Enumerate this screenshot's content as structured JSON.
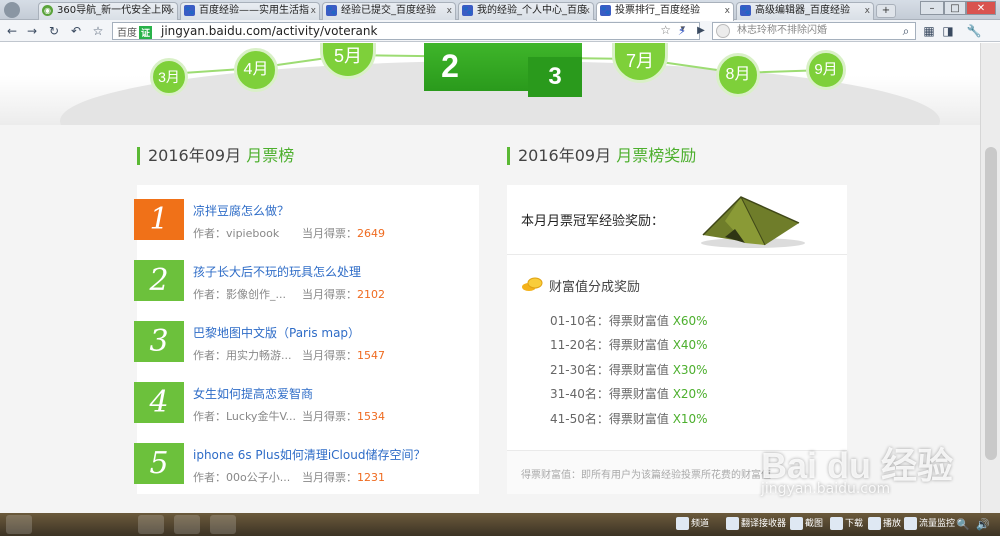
{
  "browser": {
    "tabs": [
      {
        "label": "360导航_新一代安全上网",
        "icon": "360-icon"
      },
      {
        "label": "百度经验——实用生活指",
        "icon": "paw-icon"
      },
      {
        "label": "经验已提交_百度经验",
        "icon": "paw-icon"
      },
      {
        "label": "我的经验_个人中心_百度",
        "icon": "paw-icon"
      },
      {
        "label": "投票排行_百度经验",
        "icon": "paw-icon",
        "active": true
      },
      {
        "label": "高级编辑器_百度经验",
        "icon": "paw-icon"
      }
    ],
    "new_tab_label": "+",
    "window_buttons": {
      "minimize": "–",
      "maximize": "□",
      "close": "✕"
    },
    "site_badge": "百度",
    "site_badge_tag": "证",
    "url": "jingyan.baidu.com/activity/voterank",
    "search_placeholder": "林志玲称不排除闪婚"
  },
  "timeline": {
    "months": [
      {
        "label": "3月"
      },
      {
        "label": "4月"
      },
      {
        "label": "5月"
      },
      {
        "label": "7月"
      },
      {
        "label": "8月"
      },
      {
        "label": "9月"
      }
    ],
    "podium": {
      "left": "2",
      "right": "3"
    }
  },
  "ranking": {
    "title_prefix": "2016年09月",
    "title_highlight": "月票榜",
    "author_prefix": "作者：",
    "votes_prefix": "当月得票：",
    "items": [
      {
        "rank": "1",
        "title": "凉拌豆腐怎么做？",
        "author": "vipiebook",
        "votes": "2649"
      },
      {
        "rank": "2",
        "title": "孩子长大后不玩的玩具怎么处理",
        "author": "影像创作_...",
        "votes": "2102"
      },
      {
        "rank": "3",
        "title": "巴黎地图中文版（Paris map）",
        "author": "用实力畅游...",
        "votes": "1547"
      },
      {
        "rank": "4",
        "title": "女生如何提高恋爱智商",
        "author": "Lucky金牛V...",
        "votes": "1534"
      },
      {
        "rank": "5",
        "title": "iphone 6s Plus如何清理iCloud储存空间？",
        "author": "00o公子小...",
        "votes": "1231"
      }
    ]
  },
  "reward": {
    "title_prefix": "2016年09月",
    "title_highlight": "月票榜奖励",
    "champion_label": "本月月票冠军经验奖励：",
    "wealth_title": "财富值分成奖励",
    "rows": [
      {
        "range": "01-10名：得票财富值 ",
        "pct": "X60%"
      },
      {
        "range": "11-20名：得票财富值 ",
        "pct": "X40%"
      },
      {
        "range": "21-30名：得票财富值 ",
        "pct": "X30%"
      },
      {
        "range": "31-40名：得票财富值 ",
        "pct": "X20%"
      },
      {
        "range": "41-50名：得票财富值 ",
        "pct": "X10%"
      }
    ],
    "note": "得票财富值：即所有用户为该篇经验投票所花费的财富值"
  },
  "watermark": {
    "brand": "Bai du 经验",
    "url": "jingyan.baidu.com"
  },
  "taskbar": {
    "items": [
      "频道",
      "翻译接收器",
      "截图",
      "下载",
      "播放",
      "流量监控"
    ]
  },
  "colors": {
    "accent_green": "#4caf2d",
    "first_place_orange": "#f07118",
    "link_blue": "#2e6cc7",
    "vote_orange": "#ef6b20"
  }
}
